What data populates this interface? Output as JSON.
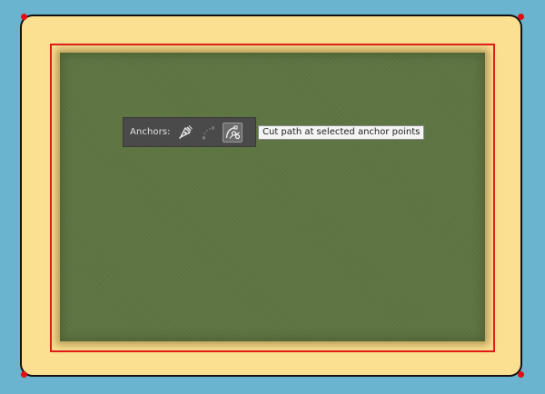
{
  "toolbar": {
    "label": "Anchors:",
    "buttons": [
      {
        "icon": "convert-anchor-pen-icon",
        "state": "enabled"
      },
      {
        "icon": "remove-anchor-handles-icon",
        "state": "disabled"
      },
      {
        "icon": "cut-path-at-anchor-icon",
        "state": "active"
      }
    ]
  },
  "tooltip": {
    "text": "Cut path at selected anchor points"
  },
  "colors": {
    "background": "#6ab4cf",
    "board": "#fce091",
    "frame": "#e31b1b",
    "panel": "#5e7543",
    "toolbar": "#4a4a4a"
  }
}
